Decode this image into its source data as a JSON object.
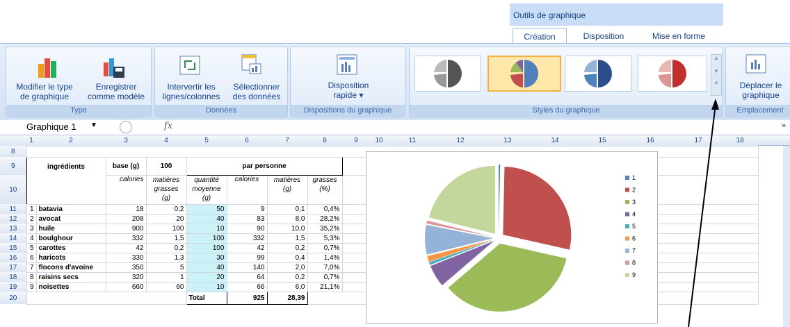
{
  "ctx": {
    "title": "Outils de graphique"
  },
  "tabs": [
    {
      "label": "Création"
    },
    {
      "label": "Disposition"
    },
    {
      "label": "Mise en forme"
    }
  ],
  "ribbon": {
    "type": {
      "label": "Type",
      "btn1": "Modifier le type",
      "btn1b": "de graphique",
      "btn2": "Enregistrer",
      "btn2b": "comme modèle"
    },
    "donnees": {
      "label": "Données",
      "btn1": "Intervertir les",
      "btn1b": "lignes/colonnes",
      "btn2": "Sélectionner",
      "btn2b": "des données"
    },
    "dispositions": {
      "label": "Dispositions du graphique",
      "btn1": "Disposition",
      "btn1b": "rapide ▾"
    },
    "styles": {
      "label": "Styles du graphique"
    },
    "emplacement": {
      "label": "Emplacement",
      "btn1": "Déplacer le",
      "btn1b": "graphique"
    }
  },
  "formula": {
    "namebox": "Graphique 1",
    "fx": "fx"
  },
  "columns": [
    "1",
    "2",
    "3",
    "4",
    "5",
    "6",
    "7",
    "8",
    "9",
    "10",
    "11",
    "12",
    "13",
    "14",
    "15",
    "16",
    "17",
    "18"
  ],
  "rownums": [
    "8",
    "9",
    "10",
    "11",
    "12",
    "13",
    "14",
    "15",
    "16",
    "17",
    "18",
    "19",
    "20"
  ],
  "header": {
    "base": "base (g)",
    "hundred": "100",
    "perperson": "par personne",
    "ingredients": "ingrédients",
    "calories": "calories",
    "mg1": "matières",
    "mg2": "grasses",
    "mg3": "(g)",
    "qm1": "quantité",
    "qm2": "moyenne",
    "qm3": "(g)",
    "cal2": "calories",
    "mat": "matières",
    "matg": "(g)",
    "gr": "grasses",
    "pct": "(%)"
  },
  "rows": [
    {
      "n": "1",
      "name": "batavia",
      "cal": "18",
      "mg": "0,2",
      "qty": "50",
      "pc": "9",
      "pm": "0,1",
      "pg": "0,4%"
    },
    {
      "n": "2",
      "name": "avocat",
      "cal": "208",
      "mg": "20",
      "qty": "40",
      "pc": "83",
      "pm": "8,0",
      "pg": "28,2%"
    },
    {
      "n": "3",
      "name": "huile",
      "cal": "900",
      "mg": "100",
      "qty": "10",
      "pc": "90",
      "pm": "10,0",
      "pg": "35,2%"
    },
    {
      "n": "4",
      "name": "boulghour",
      "cal": "332",
      "mg": "1,5",
      "qty": "100",
      "pc": "332",
      "pm": "1,5",
      "pg": "5,3%"
    },
    {
      "n": "5",
      "name": "carottes",
      "cal": "42",
      "mg": "0,2",
      "qty": "100",
      "pc": "42",
      "pm": "0,2",
      "pg": "0,7%"
    },
    {
      "n": "6",
      "name": "haricots",
      "cal": "330",
      "mg": "1,3",
      "qty": "30",
      "pc": "99",
      "pm": "0,4",
      "pg": "1,4%"
    },
    {
      "n": "7",
      "name": "flocons d'avoine",
      "cal": "350",
      "mg": "5",
      "qty": "40",
      "pc": "140",
      "pm": "2,0",
      "pg": "7,0%"
    },
    {
      "n": "8",
      "name": "raisins secs",
      "cal": "320",
      "mg": "1",
      "qty": "20",
      "pc": "64",
      "pm": "0,2",
      "pg": "0,7%"
    },
    {
      "n": "9",
      "name": "noisettes",
      "cal": "660",
      "mg": "60",
      "qty": "10",
      "pc": "66",
      "pm": "6,0",
      "pg": "21,1%"
    }
  ],
  "total": {
    "label": "Total",
    "cal": "925",
    "mg": "28,39"
  },
  "chart_data": {
    "type": "pie",
    "categories": [
      "1",
      "2",
      "3",
      "4",
      "5",
      "6",
      "7",
      "8",
      "9"
    ],
    "values": [
      0.1,
      8.0,
      10.0,
      1.5,
      0.2,
      0.4,
      2.0,
      0.2,
      6.0
    ],
    "colors": [
      "#4f81bd",
      "#c0504d",
      "#9bbb59",
      "#8064a2",
      "#4bacc6",
      "#f79646",
      "#95b3d7",
      "#d99694",
      "#c3d69b"
    ],
    "legend": "right"
  }
}
